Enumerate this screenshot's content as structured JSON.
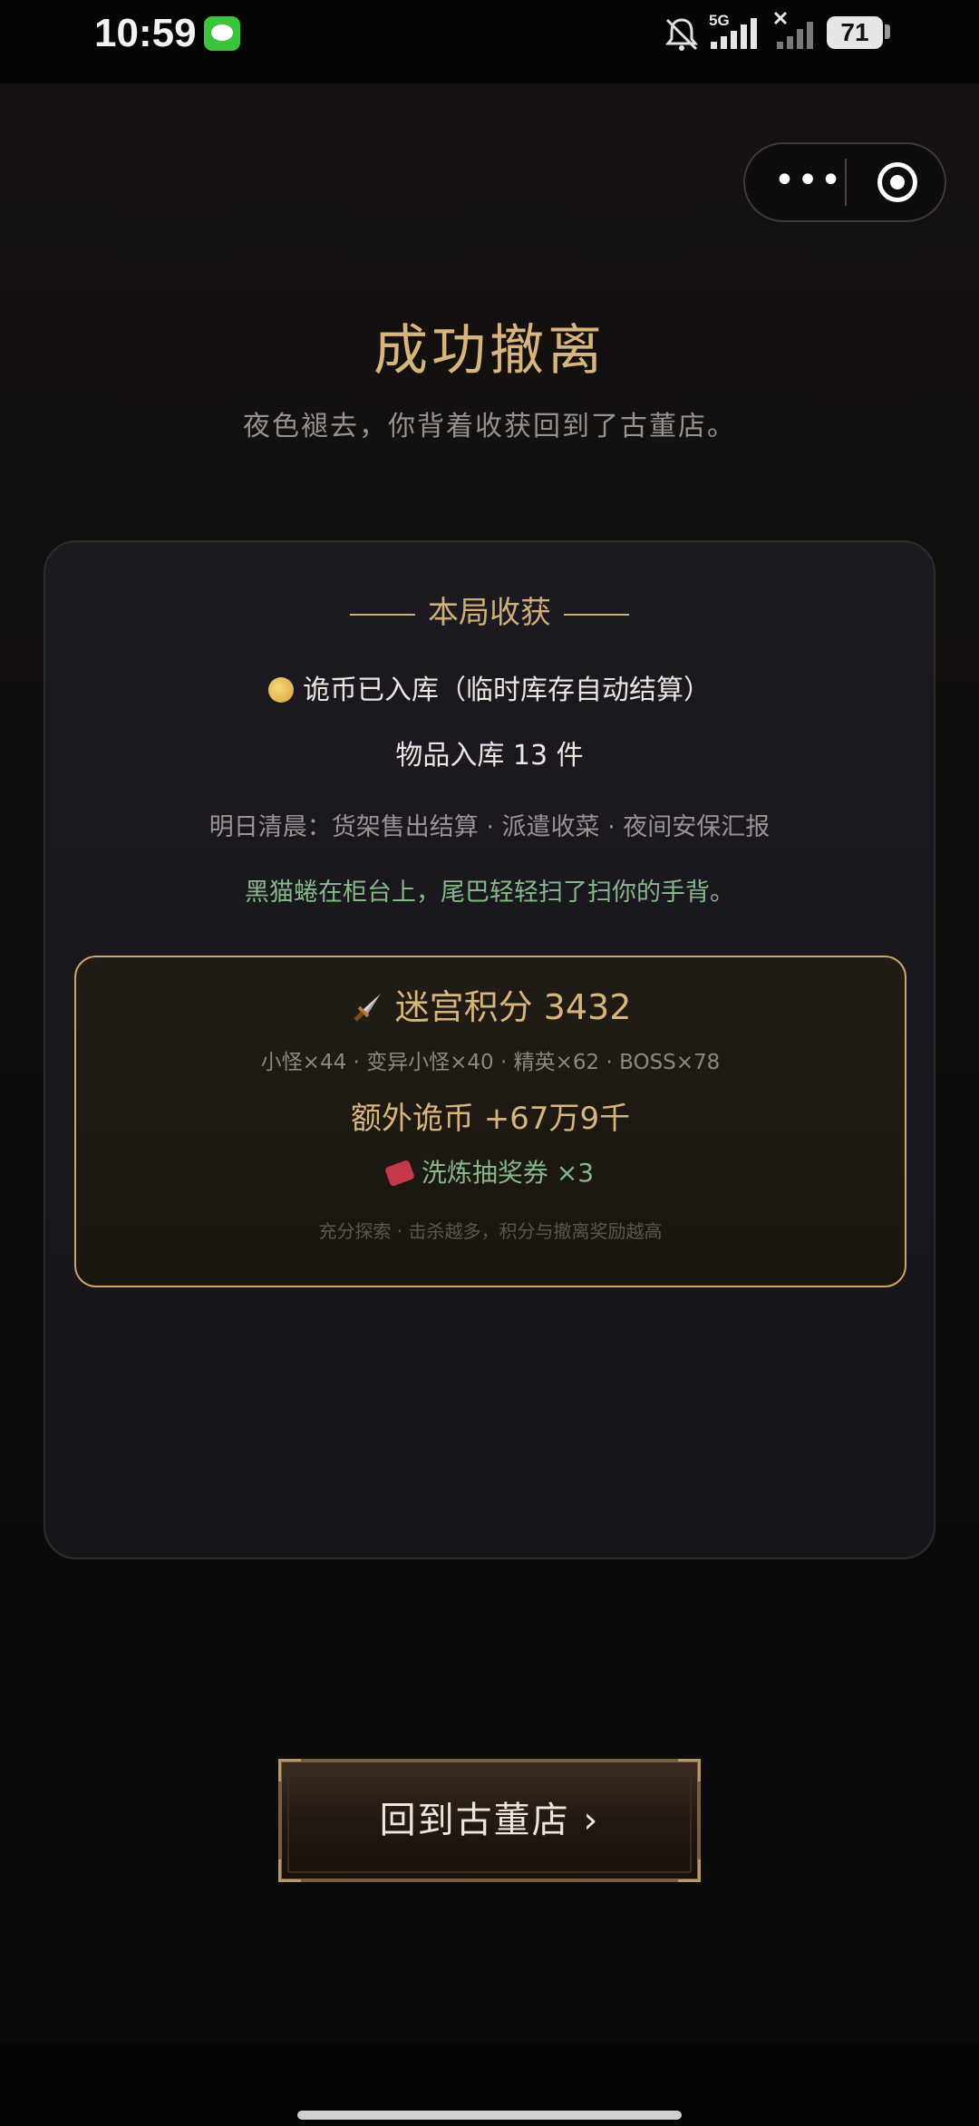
{
  "status_bar": {
    "time": "10:59",
    "battery": "71",
    "network": "5G",
    "icons": [
      "message-app-icon",
      "mute-icon",
      "signal-icon",
      "signal-off-icon",
      "battery-icon"
    ]
  },
  "capsule": {
    "more_label": "•••"
  },
  "header": {
    "title": "成功撤离",
    "subtitle": "夜色褪去，你背着收获回到了古董店。"
  },
  "summary": {
    "section_title": "本局收获",
    "coins_stored": "诡币已入库（临时库存自动结算）",
    "items_stored": "物品入库 13 件",
    "morning_events": "明日清晨：货架售出结算 · 派遣收菜 · 夜间安保汇报",
    "cat_flavor": "黑猫蜷在柜台上，尾巴轻轻扫了扫你的手背。"
  },
  "reward": {
    "score": "迷宫积分 3432",
    "kills": "小怪×44 · 变异小怪×40 · 精英×62 · BOSS×78",
    "extra_coins": "额外诡币 +67万9千",
    "ticket": "洗炼抽奖券 ×3",
    "hint": "充分探索 · 击杀越多，积分与撤离奖励越高"
  },
  "actions": {
    "back_button": "回到古董店 ›"
  },
  "colors": {
    "accent_gold": "#d7b57c",
    "accent_green": "#86b88a",
    "background": "#0e0c0c"
  }
}
